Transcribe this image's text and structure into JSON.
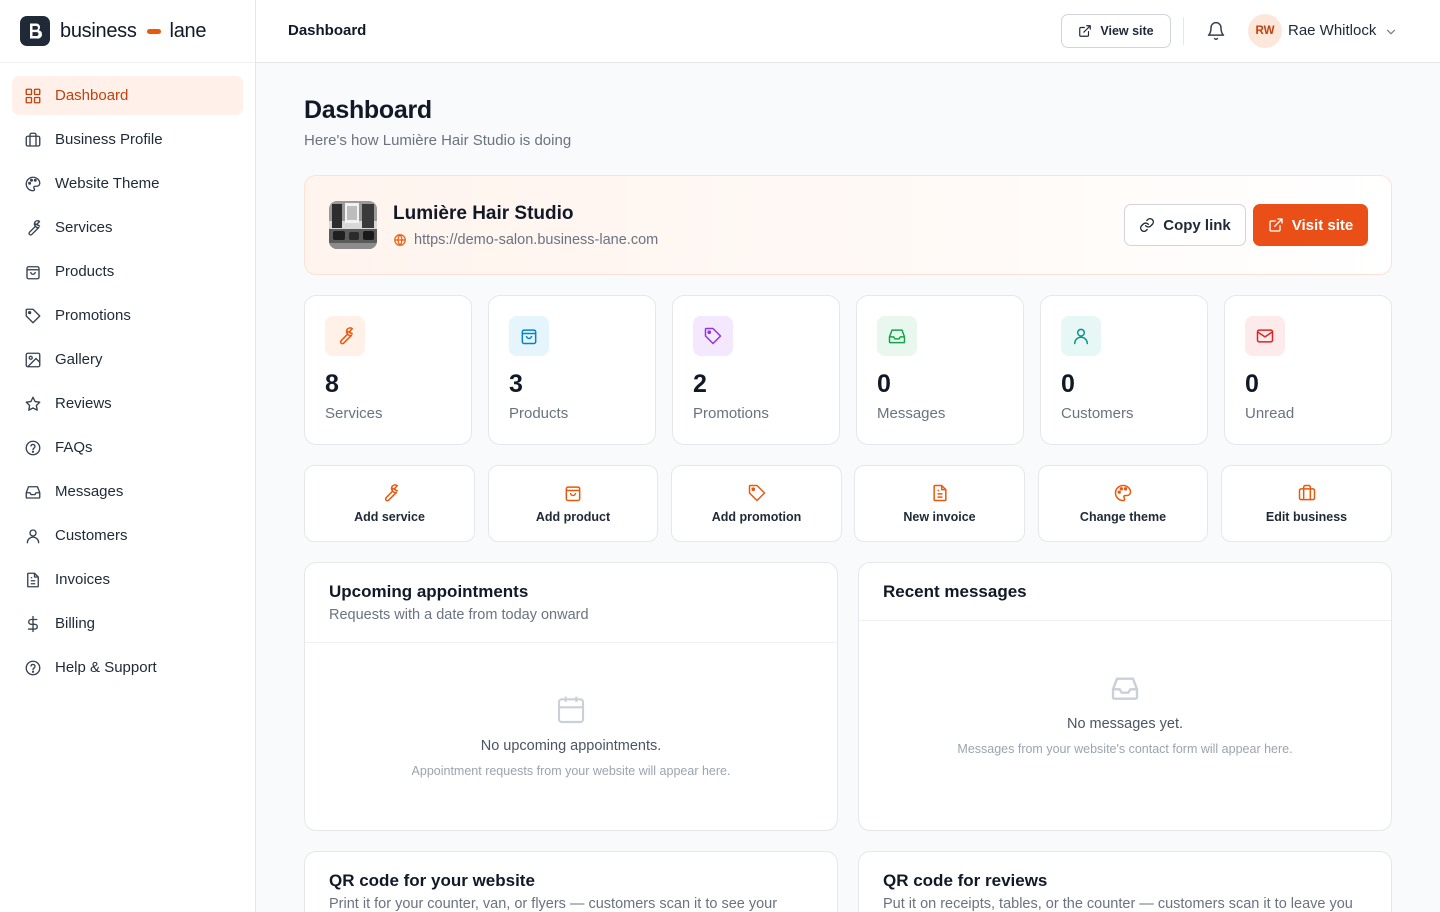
{
  "brand": {
    "left": "business",
    "right": "lane"
  },
  "nav": [
    {
      "label": "Dashboard",
      "icon": "dashboard-grid-icon",
      "active": true
    },
    {
      "label": "Business Profile",
      "icon": "briefcase-icon"
    },
    {
      "label": "Website Theme",
      "icon": "palette-icon"
    },
    {
      "label": "Services",
      "icon": "wrench-icon"
    },
    {
      "label": "Products",
      "icon": "shopping-bag-icon"
    },
    {
      "label": "Promotions",
      "icon": "tag-icon"
    },
    {
      "label": "Gallery",
      "icon": "image-icon"
    },
    {
      "label": "Reviews",
      "icon": "star-icon"
    },
    {
      "label": "FAQs",
      "icon": "help-circle-icon"
    },
    {
      "label": "Messages",
      "icon": "inbox-icon"
    },
    {
      "label": "Customers",
      "icon": "user-icon"
    },
    {
      "label": "Invoices",
      "icon": "file-text-icon"
    },
    {
      "label": "Billing",
      "icon": "dollar-icon"
    },
    {
      "label": "Help & Support",
      "icon": "help-circle-icon"
    }
  ],
  "topbar": {
    "title": "Dashboard",
    "view_site": "View site",
    "user": {
      "initials": "RW",
      "name": "Rae Whitlock"
    }
  },
  "page": {
    "title": "Dashboard",
    "subtitle": "Here's how Lumière Hair Studio is doing"
  },
  "business": {
    "name": "Lumière Hair Studio",
    "url": "https://demo-salon.business-lane.com",
    "copy_link": "Copy link",
    "visit_site": "Visit site"
  },
  "stats": [
    {
      "value": "8",
      "label": "Services",
      "icon": "wrench-icon",
      "color": "#ea580c",
      "bg": "#fff0e8"
    },
    {
      "value": "3",
      "label": "Products",
      "icon": "shopping-bag-icon",
      "color": "#0284c7",
      "bg": "#e6f4fb"
    },
    {
      "value": "2",
      "label": "Promotions",
      "icon": "tag-icon",
      "color": "#9333ea",
      "bg": "#f3e8fd"
    },
    {
      "value": "0",
      "label": "Messages",
      "icon": "inbox-icon",
      "color": "#16a34a",
      "bg": "#e8f8ee"
    },
    {
      "value": "0",
      "label": "Customers",
      "icon": "user-icon",
      "color": "#0d9488",
      "bg": "#e6f7f5"
    },
    {
      "value": "0",
      "label": "Unread",
      "icon": "mail-icon",
      "color": "#dc2626",
      "bg": "#fdeaea"
    }
  ],
  "actions": [
    {
      "label": "Add service",
      "icon": "wrench-icon"
    },
    {
      "label": "Add product",
      "icon": "shopping-bag-icon"
    },
    {
      "label": "Add promotion",
      "icon": "tag-icon"
    },
    {
      "label": "New invoice",
      "icon": "file-text-icon"
    },
    {
      "label": "Change theme",
      "icon": "palette-icon"
    },
    {
      "label": "Edit business",
      "icon": "briefcase-icon"
    }
  ],
  "appointments": {
    "title": "Upcoming appointments",
    "subtitle": "Requests with a date from today onward",
    "empty_title": "No upcoming appointments.",
    "empty_sub": "Appointment requests from your website will appear here."
  },
  "messages": {
    "title": "Recent messages",
    "empty_title": "No messages yet.",
    "empty_sub": "Messages from your website's contact form will appear here."
  },
  "qr_website": {
    "title": "QR code for your website",
    "subtitle": "Print it for your counter, van, or flyers — customers scan it to see your"
  },
  "qr_reviews": {
    "title": "QR code for reviews",
    "subtitle": "Put it on receipts, tables, or the counter — customers scan it to leave you"
  },
  "colors": {
    "accent": "#ea4f17",
    "active_bg": "#fff1ea",
    "active_text": "#c2410c"
  }
}
